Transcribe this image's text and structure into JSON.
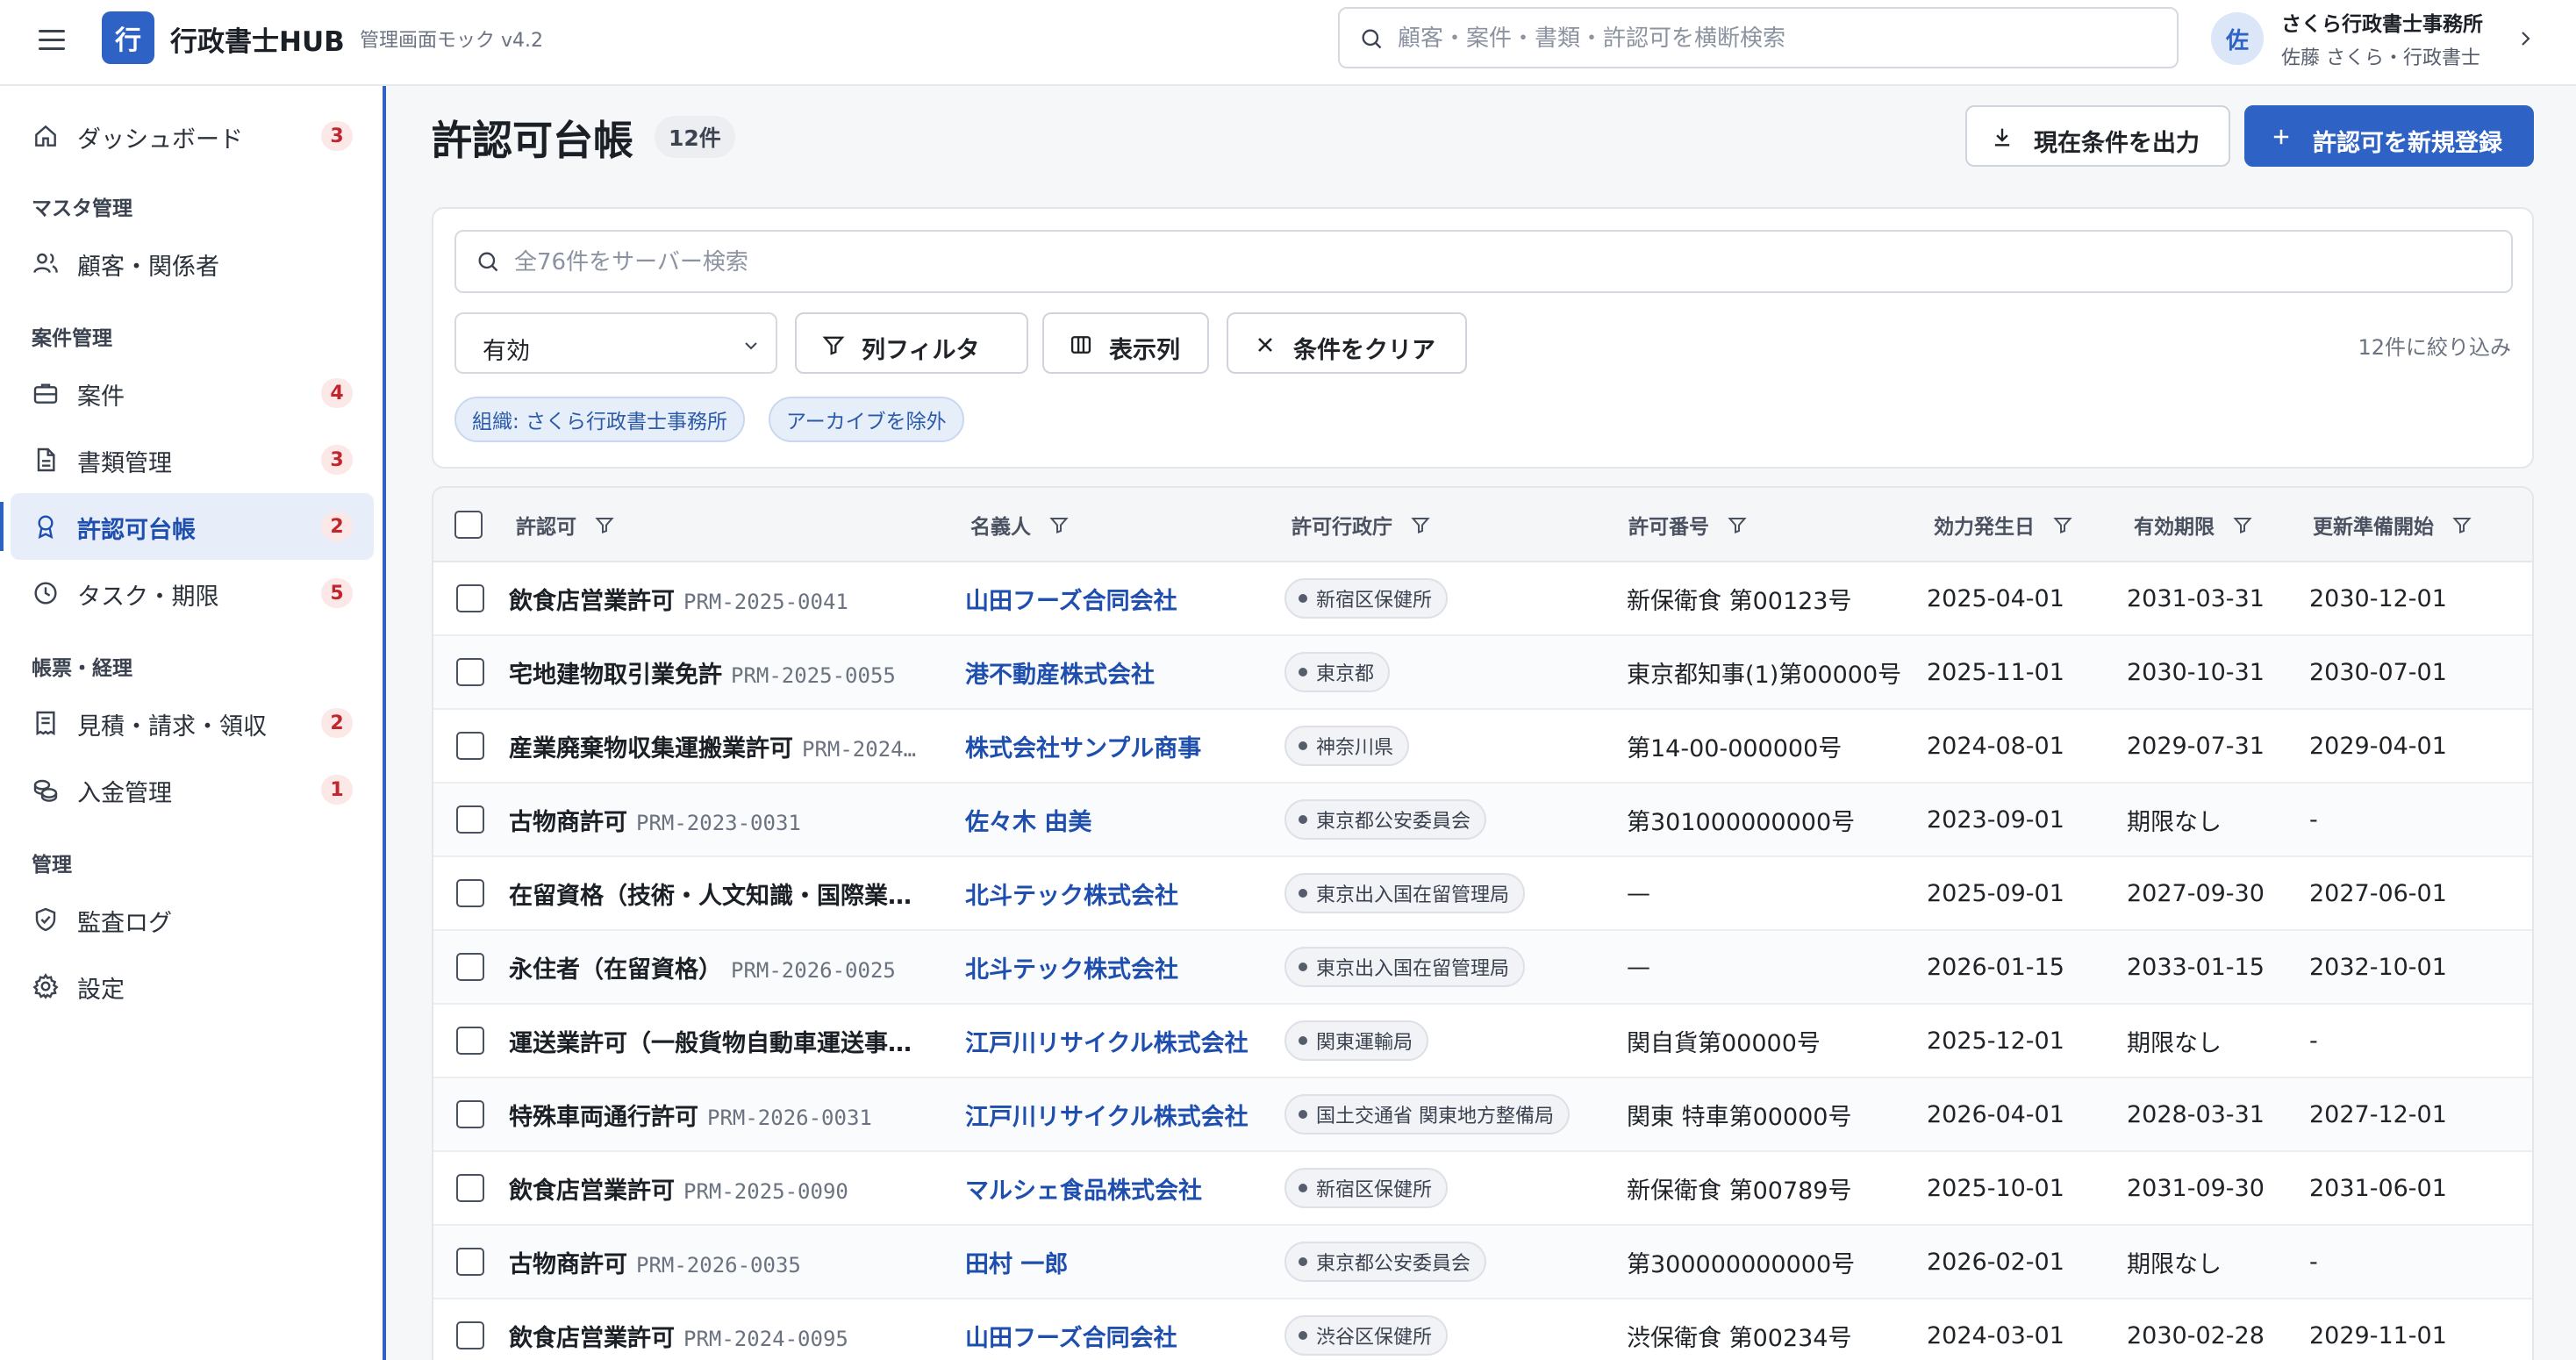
{
  "header": {
    "logo_char": "行",
    "brand": "行政書士HUB",
    "subtitle": "管理画面モック v4.2",
    "search_placeholder": "顧客・案件・書類・許認可を横断検索",
    "avatar_char": "佐",
    "org_name": "さくら行政書士事務所",
    "user_name": "佐藤 さくら・行政書士"
  },
  "sidebar": {
    "dashboard": {
      "label": "ダッシュボード",
      "badge": "3",
      "icon": "home-icon"
    },
    "sections": {
      "master": "マスタ管理",
      "cases": "案件管理",
      "billing": "帳票・経理",
      "admin": "管理"
    },
    "items": [
      {
        "label": "顧客・関係者",
        "badge": "",
        "icon": "users-icon"
      },
      {
        "label": "案件",
        "badge": "4",
        "icon": "briefcase-icon"
      },
      {
        "label": "書類管理",
        "badge": "3",
        "icon": "document-icon"
      },
      {
        "label": "許認可台帳",
        "badge": "2",
        "icon": "award-icon",
        "active": true
      },
      {
        "label": "タスク・期限",
        "badge": "5",
        "icon": "clock-icon"
      },
      {
        "label": "見積・請求・領収",
        "badge": "2",
        "icon": "receipt-icon"
      },
      {
        "label": "入金管理",
        "badge": "1",
        "icon": "coins-icon"
      },
      {
        "label": "監査ログ",
        "badge": "",
        "icon": "shield-check-icon"
      },
      {
        "label": "設定",
        "badge": "",
        "icon": "gear-icon"
      }
    ]
  },
  "main": {
    "title": "許認可台帳",
    "count": "12件",
    "export_label": "現在条件を出力",
    "create_label": "許認可を新規登録",
    "filter": {
      "search_placeholder": "全76件をサーバー検索",
      "status_value": "有効",
      "column_filter_label": "列フィルタ",
      "columns_label": "表示列",
      "clear_label": "条件をクリア",
      "result_text": "12件に絞り込み",
      "chips": [
        "組織: さくら行政書士事務所",
        "アーカイブを除外"
      ]
    },
    "table": {
      "headers": [
        "許認可",
        "名義人",
        "許可行政庁",
        "許可番号",
        "効力発生日",
        "有効期限",
        "更新準備開始"
      ],
      "rows": [
        {
          "name": "飲食店営業許可",
          "code": "PRM-2025-0041",
          "holder": "山田フーズ合同会社",
          "agency": "新宿区保健所",
          "number": "新保衛食 第00123号",
          "effective": "2025-04-01",
          "expiry": "2031-03-31",
          "renewal": "2030-12-01"
        },
        {
          "name": "宅地建物取引業免許",
          "code": "PRM-2025-0055",
          "holder": "港不動産株式会社",
          "agency": "東京都",
          "number": "東京都知事(1)第00000号",
          "effective": "2025-11-01",
          "expiry": "2030-10-31",
          "renewal": "2030-07-01"
        },
        {
          "name": "産業廃棄物収集運搬業許可",
          "code": "PRM-2024…",
          "holder": "株式会社サンプル商事",
          "agency": "神奈川県",
          "number": "第14-00-000000号",
          "effective": "2024-08-01",
          "expiry": "2029-07-31",
          "renewal": "2029-04-01"
        },
        {
          "name": "古物商許可",
          "code": "PRM-2023-0031",
          "holder": "佐々木 由美",
          "agency": "東京都公安委員会",
          "number": "第301000000000号",
          "effective": "2023-09-01",
          "expiry": "期限なし",
          "renewal": "-"
        },
        {
          "name": "在留資格（技術・人文知識・国際業…",
          "code": "",
          "holder": "北斗テック株式会社",
          "agency": "東京出入国在留管理局",
          "number": "—",
          "effective": "2025-09-01",
          "expiry": "2027-09-30",
          "renewal": "2027-06-01"
        },
        {
          "name": "永住者（在留資格）",
          "code": "PRM-2026-0025",
          "holder": "北斗テック株式会社",
          "agency": "東京出入国在留管理局",
          "number": "—",
          "effective": "2026-01-15",
          "expiry": "2033-01-15",
          "renewal": "2032-10-01"
        },
        {
          "name": "運送業許可（一般貨物自動車運送事…",
          "code": "",
          "holder": "江戸川リサイクル株式会社",
          "agency": "関東運輸局",
          "number": "関自貨第00000号",
          "effective": "2025-12-01",
          "expiry": "期限なし",
          "renewal": "-"
        },
        {
          "name": "特殊車両通行許可",
          "code": "PRM-2026-0031",
          "holder": "江戸川リサイクル株式会社",
          "agency": "国土交通省 関東地方整備局",
          "number": "関東 特車第00000号",
          "effective": "2026-04-01",
          "expiry": "2028-03-31",
          "renewal": "2027-12-01"
        },
        {
          "name": "飲食店営業許可",
          "code": "PRM-2025-0090",
          "holder": "マルシェ食品株式会社",
          "agency": "新宿区保健所",
          "number": "新保衛食 第00789号",
          "effective": "2025-10-01",
          "expiry": "2031-09-30",
          "renewal": "2031-06-01"
        },
        {
          "name": "古物商許可",
          "code": "PRM-2026-0035",
          "holder": "田村 一郎",
          "agency": "東京都公安委員会",
          "number": "第300000000000号",
          "effective": "2026-02-01",
          "expiry": "期限なし",
          "renewal": "-"
        },
        {
          "name": "飲食店営業許可",
          "code": "PRM-2024-0095",
          "holder": "山田フーズ合同会社",
          "agency": "渋谷区保健所",
          "number": "渋保衛食 第00234号",
          "effective": "2024-03-01",
          "expiry": "2030-02-28",
          "renewal": "2029-11-01"
        }
      ]
    }
  },
  "colors": {
    "accent": "#2f62c5",
    "badge_bg": "#fde8e8",
    "badge_text": "#c0262d",
    "link": "#1f4fae"
  }
}
